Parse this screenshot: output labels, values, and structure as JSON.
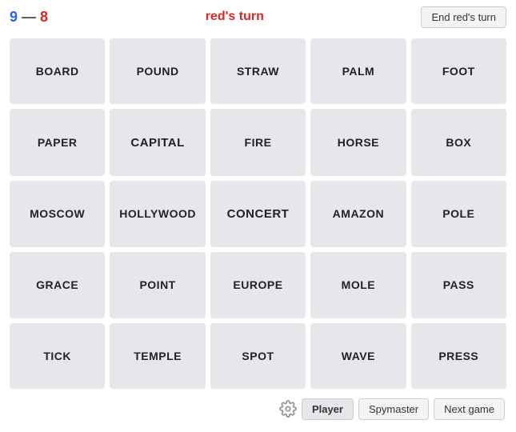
{
  "header": {
    "blue_score": "9",
    "dash": "—",
    "red_score": "8",
    "turn_label": "red's turn",
    "end_turn_button": "End red's turn"
  },
  "grid": {
    "cards": [
      {
        "id": "board",
        "label": "BOARD"
      },
      {
        "id": "pound",
        "label": "POUND"
      },
      {
        "id": "straw",
        "label": "STRAW"
      },
      {
        "id": "palm",
        "label": "PALM"
      },
      {
        "id": "foot",
        "label": "FOOT"
      },
      {
        "id": "paper",
        "label": "PAPER"
      },
      {
        "id": "capital",
        "label": "CAPITAL",
        "special": true
      },
      {
        "id": "fire",
        "label": "FIRE"
      },
      {
        "id": "horse",
        "label": "HORSE"
      },
      {
        "id": "box",
        "label": "BOX"
      },
      {
        "id": "moscow",
        "label": "MOSCOW"
      },
      {
        "id": "hollywood",
        "label": "HOLLYWOOD"
      },
      {
        "id": "concert",
        "label": "CONCERT",
        "special": true
      },
      {
        "id": "amazon",
        "label": "AMAZON"
      },
      {
        "id": "pole",
        "label": "POLE"
      },
      {
        "id": "grace",
        "label": "GRACE"
      },
      {
        "id": "point",
        "label": "POINT"
      },
      {
        "id": "europe",
        "label": "EUROPE"
      },
      {
        "id": "mole",
        "label": "MOLE"
      },
      {
        "id": "pass",
        "label": "PASS"
      },
      {
        "id": "tick",
        "label": "TICK"
      },
      {
        "id": "temple",
        "label": "TEMPLE"
      },
      {
        "id": "spot",
        "label": "SPOT"
      },
      {
        "id": "wave",
        "label": "WAVE"
      },
      {
        "id": "press",
        "label": "PRESS"
      }
    ]
  },
  "footer": {
    "player_label": "Player",
    "spymaster_label": "Spymaster",
    "next_game_label": "Next game"
  }
}
